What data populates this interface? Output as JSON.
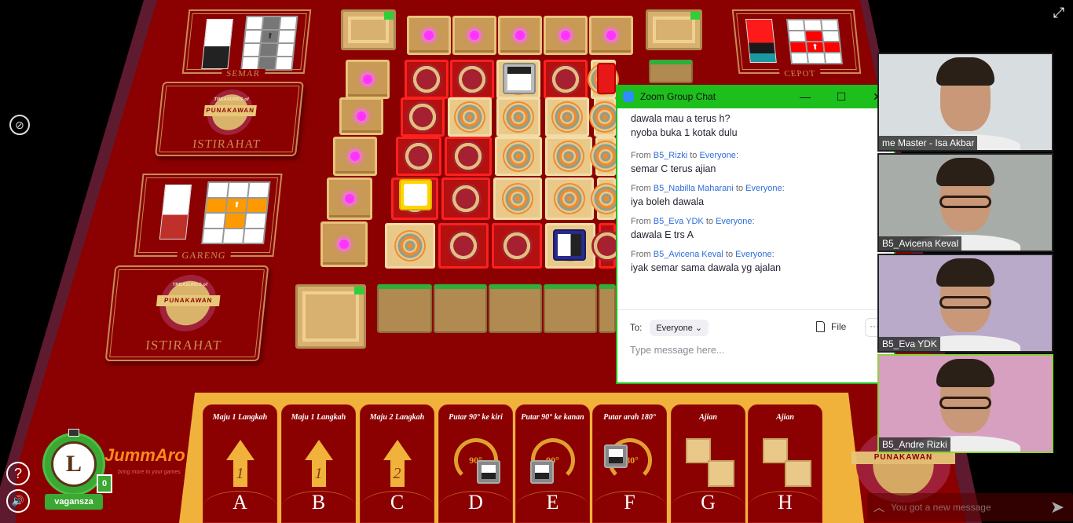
{
  "game": {
    "characters": [
      {
        "name": "SEMAR",
        "pawn_color": "#ffffff",
        "pattern_color": "#777777"
      },
      {
        "name": "GARENG",
        "pawn_color": "#ffffff",
        "pattern_color": "#ff9900"
      },
      {
        "name": "CEPOT",
        "pawn_color": "#ff1a1a",
        "pattern_color": "#ff0000"
      }
    ],
    "rest_cards": [
      {
        "logo_top": "TREASURES of",
        "logo_band": "PUNAKAWAN",
        "label": "ISTIRAHAT"
      },
      {
        "logo_top": "TREASURES of",
        "logo_band": "PUNAKAWAN",
        "label": "ISTIRAHAT"
      }
    ],
    "action_cards": [
      {
        "title": "Maju 1 Langkah",
        "type": "forward",
        "steps": "1",
        "letter": "A"
      },
      {
        "title": "Maju 1 Langkah",
        "type": "forward",
        "steps": "1",
        "letter": "B"
      },
      {
        "title": "Maju 2 Langkah",
        "type": "forward",
        "steps": "2",
        "letter": "C"
      },
      {
        "title": "Putar 90° ke kiri",
        "type": "rotate",
        "angle": "90°",
        "letter": "D"
      },
      {
        "title": "Putar 90° ke kanan",
        "type": "rotate",
        "angle": "90°",
        "letter": "E"
      },
      {
        "title": "Putar arah 180°",
        "type": "rotate",
        "angle": "180°",
        "letter": "F"
      },
      {
        "title": "Ajian",
        "type": "ajian",
        "letter": "G"
      },
      {
        "title": "Ajian",
        "type": "ajian",
        "letter": "H"
      }
    ],
    "player": {
      "username": "vagansza",
      "avatar_letter": "L",
      "card_count": "0"
    },
    "brand": {
      "name": "JummAro",
      "tagline": "bring more to your games"
    },
    "corner_logo": {
      "band": "PUNAKAWAN"
    },
    "help_label": "?",
    "sound_label": "🔊"
  },
  "zoom_chat": {
    "title": "Zoom Group Chat",
    "controls": {
      "minimize": "—",
      "maximize": "☐",
      "close": "✕"
    },
    "messages": [
      {
        "from": null,
        "to": null,
        "text": "dawala mau a terus h?"
      },
      {
        "from": null,
        "to": null,
        "text": "nyoba buka 1 kotak dulu"
      },
      {
        "from": "B5_Rizki",
        "to": "Everyone",
        "text": "semar C terus ajian"
      },
      {
        "from": "B5_Nabilla Maharani",
        "to": "Everyone",
        "text": "iya boleh dawala"
      },
      {
        "from": "B5_Eva YDK",
        "to": "Everyone",
        "text": "dawala E trs A"
      },
      {
        "from": "B5_Avicena Keval",
        "to": "Everyone",
        "text": "iyak semar sama dawala yg ajalan"
      }
    ],
    "from_word": "From",
    "to_word": "to",
    "to_label": "To:",
    "recipient": "Everyone",
    "file_label": "File",
    "more_label": "···",
    "input_placeholder": "Type message here..."
  },
  "participants": [
    {
      "name": "me Master - Isa Akbar",
      "bg": "#d8dde0",
      "glasses": false,
      "active": false
    },
    {
      "name": "B5_Avicena Keval",
      "bg": "#a8aca8",
      "glasses": true,
      "active": false
    },
    {
      "name": "B5_Eva YDK",
      "bg": "#b8aac8",
      "glasses": true,
      "active": false
    },
    {
      "name": "B5_Andre Rizki",
      "bg": "#d8a0c0",
      "glasses": true,
      "active": true
    }
  ],
  "notification": {
    "text": "You got a new message"
  }
}
